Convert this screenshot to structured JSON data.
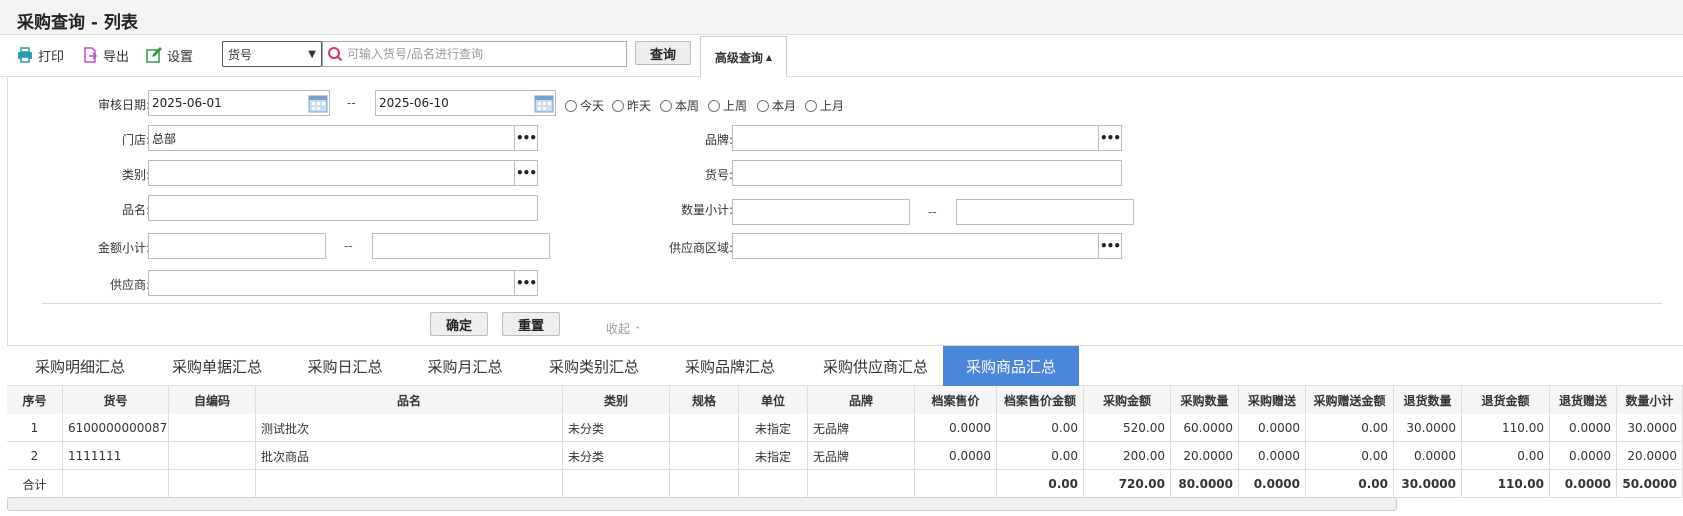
{
  "title": "采购查询 - 列表",
  "toolbar": {
    "print": "打印",
    "export": "导出",
    "settings": "设置",
    "select_value": "货号",
    "search_placeholder": "可输入货号/品名进行查询",
    "query": "查询",
    "advanced": "高级查询"
  },
  "form": {
    "audit_date_label": "审核日期:",
    "date_from": "2025-06-01",
    "date_to": "2025-06-10",
    "dash": "--",
    "quick_dates": [
      "今天",
      "昨天",
      "本周",
      "上周",
      "本月",
      "上月"
    ],
    "store_label": "门店:",
    "store_value": "总部",
    "brand_label": "品牌:",
    "category_label": "类别:",
    "item_no_label": "货号:",
    "name_label": "品名:",
    "qty_label": "数量小计:",
    "amount_label": "金额小计:",
    "region_label": "供应商区域:",
    "supplier_label": "供应商:",
    "confirm": "确定",
    "reset": "重置",
    "collapse": "收起"
  },
  "tabs": [
    "采购明细汇总",
    "采购单据汇总",
    "采购日汇总",
    "采购月汇总",
    "采购类别汇总",
    "采购品牌汇总",
    "采购供应商汇总",
    "采购商品汇总"
  ],
  "active_tab": 7,
  "table": {
    "headers": [
      "序号",
      "货号",
      "自编码",
      "品名",
      "类别",
      "规格",
      "单位",
      "品牌",
      "档案售价",
      "档案售价金额",
      "采购金额",
      "采购数量",
      "采购赠送",
      "采购赠送金额",
      "退货数量",
      "退货金额",
      "退货赠送",
      "数量小计"
    ],
    "rows": [
      [
        "1",
        "6100000000087",
        "",
        "测试批次",
        "未分类",
        "",
        "未指定",
        "无品牌",
        "0.0000",
        "0.00",
        "520.00",
        "60.0000",
        "0.0000",
        "0.00",
        "30.0000",
        "110.00",
        "0.0000",
        "30.0000"
      ],
      [
        "2",
        "1111111",
        "",
        "批次商品",
        "未分类",
        "",
        "未指定",
        "无品牌",
        "0.0000",
        "0.00",
        "200.00",
        "20.0000",
        "0.0000",
        "0.00",
        "0.0000",
        "0.00",
        "0.0000",
        "20.0000"
      ]
    ],
    "total": [
      "合计",
      "",
      "",
      "",
      "",
      "",
      "",
      "",
      "",
      "0.00",
      "720.00",
      "80.0000",
      "0.0000",
      "0.00",
      "30.0000",
      "110.00",
      "0.0000",
      "50.0000"
    ]
  }
}
